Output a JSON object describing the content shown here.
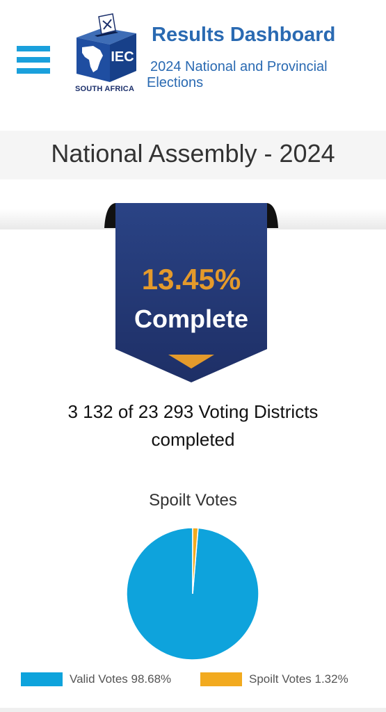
{
  "header": {
    "title": "Results Dashboard",
    "subtitle": "2024 National and Provincial Elections",
    "logo_caption": "SOUTH AFRICA",
    "logo_text": "IEC",
    "menu_icon": "hamburger-menu-icon"
  },
  "section": {
    "title": "National Assembly - 2024"
  },
  "progress": {
    "percent_text": "13.45%",
    "percent_value": 13.45,
    "label": "Complete",
    "districts_line1": "3 132 of 23 293 Voting Districts",
    "districts_line2": "completed"
  },
  "chart_data": {
    "type": "pie",
    "title": "Spoilt Votes",
    "slices": [
      {
        "name": "Valid Votes",
        "label": "Valid Votes 98.68%",
        "value": 98.68,
        "color": "#0ea3dc"
      },
      {
        "name": "Spoilt Votes",
        "label": "Spoilt Votes 1.32%",
        "value": 1.32,
        "color": "#f2aa1f"
      }
    ],
    "legend_position": "bottom"
  },
  "colors": {
    "accent_blue": "#1aa0dc",
    "ribbon_navy": "#233878",
    "highlight_orange": "#e49a2b",
    "title_blue": "#2a6ab2"
  }
}
